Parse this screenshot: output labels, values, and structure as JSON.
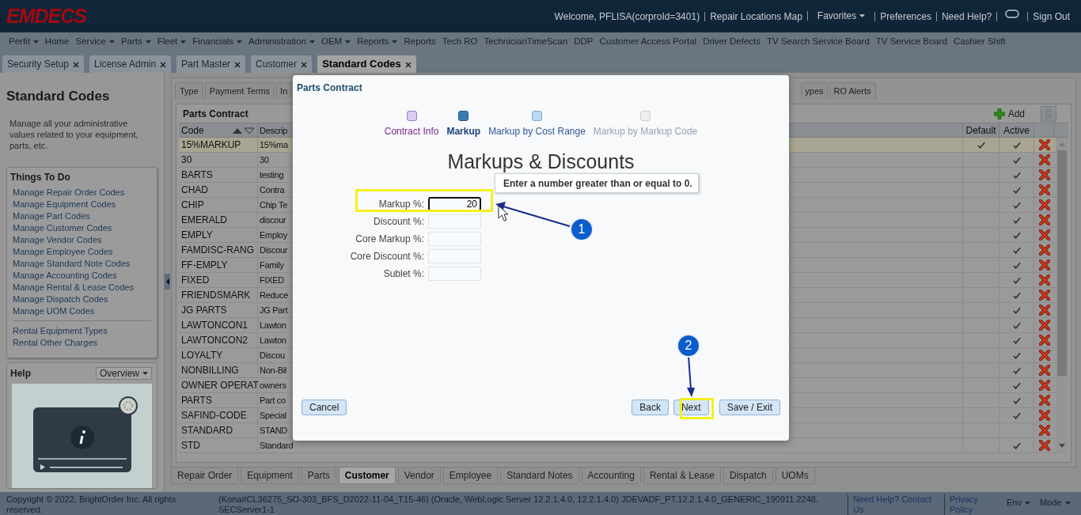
{
  "header": {
    "logo": "EMDECS",
    "welcome": "Welcome, PFLISA(corproId=3401)",
    "links": [
      {
        "label": "Repair Locations Map",
        "dropdown": false
      },
      {
        "label": "Favorites",
        "dropdown": true
      },
      {
        "label": "Preferences",
        "dropdown": false
      },
      {
        "label": "Need Help?",
        "dropdown": false
      },
      {
        "label": "Sign Out",
        "dropdown": false,
        "kind": "after-chat"
      }
    ]
  },
  "menu": [
    {
      "label": "Perfit",
      "dropdown": true
    },
    {
      "label": "Home",
      "dropdown": false
    },
    {
      "label": "Service",
      "dropdown": true
    },
    {
      "label": "Parts",
      "dropdown": true
    },
    {
      "label": "Fleet",
      "dropdown": true
    },
    {
      "label": "Financials",
      "dropdown": true
    },
    {
      "label": "Administration",
      "dropdown": true
    },
    {
      "label": "OEM",
      "dropdown": true
    },
    {
      "label": "Reports",
      "dropdown": true
    },
    {
      "label": "Reports",
      "dropdown": false
    },
    {
      "label": "Tech RO",
      "dropdown": false
    },
    {
      "label": "TechnicianTimeScan",
      "dropdown": false
    },
    {
      "label": "DDP",
      "dropdown": false
    },
    {
      "label": "Customer Access Portal",
      "dropdown": false
    },
    {
      "label": "Driver Defects",
      "dropdown": false
    },
    {
      "label": "TV Search Service Board",
      "dropdown": false
    },
    {
      "label": "TV Service Board",
      "dropdown": false
    },
    {
      "label": "Cashier Shift",
      "dropdown": false
    }
  ],
  "doc_tabs": [
    {
      "label": "Security Setup",
      "selected": false
    },
    {
      "label": "License Admin",
      "selected": false
    },
    {
      "label": "Part Master",
      "selected": false
    },
    {
      "label": "Customer",
      "selected": false
    },
    {
      "label": "Standard Codes",
      "selected": true
    }
  ],
  "left_panel": {
    "title": "Standard Codes",
    "description": "Manage all your administrative values related to your equipment, parts, etc.",
    "things_to_do": {
      "title": "Things To Do",
      "groups": [
        [
          "Manage Repair Order Codes",
          "Manage Equipment Codes",
          "Manage Part Codes",
          "Manage Customer Codes",
          "Manage Vendor Codes",
          "Manage Employee Codes",
          "Manage Standard Note Codes",
          "Manage Accounting Codes",
          "Manage Rental & Lease Codes",
          "Manage Dispatch Codes",
          "Manage UOM Codes"
        ],
        [
          "Rental Equipment Types",
          "Rental Other Charges"
        ]
      ]
    },
    "help": {
      "title": "Help",
      "dropdown": "Overview"
    }
  },
  "top_tabs": [
    {
      "label": "Type",
      "selected": false
    },
    {
      "label": "Payment Terms",
      "selected": false
    },
    {
      "label": "In",
      "selected": false,
      "kind": "cut"
    },
    {
      "label": "ypes",
      "selected": false,
      "kind": "cut"
    },
    {
      "label": "RO Alerts",
      "selected": false
    }
  ],
  "table": {
    "title": "Parts Contract",
    "add_label": "Add",
    "columns": [
      "Code",
      "Descrip",
      "Default",
      "Active"
    ],
    "rows": [
      {
        "code": "15%MARKUP",
        "description": "15%ma",
        "default": true,
        "active": true,
        "selected": true
      },
      {
        "code": "30",
        "description": "30",
        "default": false,
        "active": true,
        "selected": false
      },
      {
        "code": "BARTS",
        "description": "testing",
        "default": false,
        "active": true,
        "selected": false
      },
      {
        "code": "CHAD",
        "description": "Contra",
        "default": false,
        "active": true,
        "selected": false
      },
      {
        "code": "CHIP",
        "description": "Chip Te",
        "default": false,
        "active": true,
        "selected": false
      },
      {
        "code": "EMERALD",
        "description": "discour",
        "default": false,
        "active": true,
        "selected": false
      },
      {
        "code": "EMPLY",
        "description": "Employ",
        "default": false,
        "active": true,
        "selected": false
      },
      {
        "code": "FAMDISC-RANG",
        "description": "Discour",
        "default": false,
        "active": true,
        "selected": false
      },
      {
        "code": "FF-EMPLY",
        "description": "Family",
        "default": false,
        "active": true,
        "selected": false
      },
      {
        "code": "FIXED",
        "description": "FIXED",
        "default": false,
        "active": true,
        "selected": false
      },
      {
        "code": "FRIENDSMARK",
        "description": "Reduce",
        "default": false,
        "active": true,
        "selected": false
      },
      {
        "code": "JG PARTS",
        "description": "JG Part",
        "default": false,
        "active": true,
        "selected": false
      },
      {
        "code": "LAWTONCON1",
        "description": "Lawton",
        "default": false,
        "active": true,
        "selected": false
      },
      {
        "code": "LAWTONCON2",
        "description": "Lawton",
        "default": false,
        "active": true,
        "selected": false
      },
      {
        "code": "LOYALTY",
        "description": "Discou",
        "default": false,
        "active": true,
        "selected": false
      },
      {
        "code": "NONBILLING",
        "description": "Non-Bil",
        "default": false,
        "active": true,
        "selected": false
      },
      {
        "code": "OWNER OPERAT",
        "description": "owners",
        "default": false,
        "active": true,
        "selected": false
      },
      {
        "code": "PARTS",
        "description": "Part co",
        "default": false,
        "active": true,
        "selected": false
      },
      {
        "code": "SAFIND-CODE",
        "description": "Special",
        "default": false,
        "active": true,
        "selected": false
      },
      {
        "code": "STANDARD",
        "description": "STAND",
        "default": false,
        "active": false,
        "selected": false
      },
      {
        "code": "STD",
        "description": "Standard",
        "default": false,
        "active": true,
        "selected": false
      }
    ]
  },
  "bottom_tabs": [
    {
      "label": "Repair Order",
      "selected": false
    },
    {
      "label": "Equipment",
      "selected": false
    },
    {
      "label": "Parts",
      "selected": false
    },
    {
      "label": "Customer",
      "selected": true
    },
    {
      "label": "Vendor",
      "selected": false
    },
    {
      "label": "Employee",
      "selected": false
    },
    {
      "label": "Standard Notes",
      "selected": false
    },
    {
      "label": "Accounting",
      "selected": false
    },
    {
      "label": "Rental & Lease",
      "selected": false
    },
    {
      "label": "Dispatch",
      "selected": false
    },
    {
      "label": "UOMs",
      "selected": false
    }
  ],
  "footer": {
    "copyright": "Copyright © 2022, BrightOrder Inc. All rights reserved.",
    "version": "(Kona#CL36275_SO-303_BFS_D2022-11-04_T15-46) (Oracle, WebLogic Server 12.2.1.4.0, 12.2.1.4.0) JDEVADF_PT.12.2.1.4.0_GENERIC_190911.2248.SECServer1-1",
    "links": [
      "Need Help? Contact Us.",
      "Privacy Policy"
    ],
    "menus": [
      "Env",
      "Mode"
    ]
  },
  "dialog": {
    "title": "Parts Contract",
    "steps": [
      {
        "label": "Contract Info",
        "done": true,
        "current": false,
        "disabled": false
      },
      {
        "label": "Markup",
        "done": false,
        "current": true,
        "disabled": false
      },
      {
        "label": "Markup by Cost Range",
        "done": false,
        "current": false,
        "disabled": false
      },
      {
        "label": "Markup by Markup Code",
        "done": false,
        "current": false,
        "disabled": true
      }
    ],
    "heading": "Markups & Discounts",
    "tooltip": "Enter a number greater than or equal to 0.",
    "fields": [
      {
        "label": "Markup %:",
        "value": "20",
        "focused": true
      },
      {
        "label": "Discount %:",
        "focused": false
      },
      {
        "label": "Core Markup %:",
        "focused": false
      },
      {
        "label": "Core Discount %:",
        "focused": false
      },
      {
        "label": "Sublet %:",
        "focused": false
      }
    ],
    "buttons": {
      "left": [
        "Cancel"
      ],
      "right": [
        "Back",
        "Next",
        "Save / Exit"
      ]
    }
  },
  "annotations": [
    {
      "number": "1"
    },
    {
      "number": "2"
    }
  ]
}
